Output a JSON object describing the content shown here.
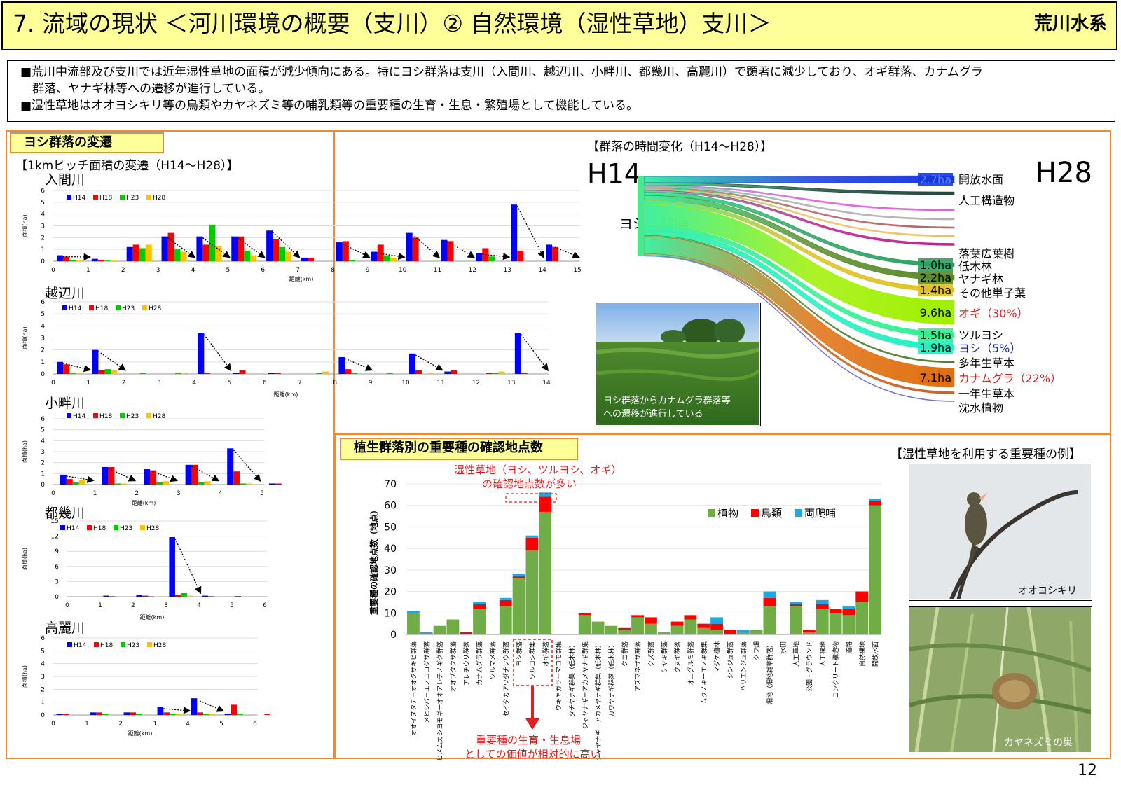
{
  "header": {
    "title": "7. 流域の現状 ＜河川環境の概要（支川）② 自然環境（湿性草地）支川＞",
    "system": "荒川水系"
  },
  "summary": {
    "line1": "■荒川中流部及び支川では近年湿性草地の面積が減少傾向にある。特にヨシ群落は支川（入間川、越辺川、小畔川、都幾川、高麗川）で顕著に減少しており、オギ群落、カナムグラ",
    "line2": "群落、ヤナギ林等への遷移が進行している。",
    "line3": "■湿性草地はオオヨシキリ等の鳥類やカヤネズミ等の哺乳類等の重要種の生育・生息・繁殖場として機能している。"
  },
  "left_panel": {
    "tag": "ヨシ群落の変遷",
    "subtitle": "【1kmピッチ面積の変遷（H14～H28）】",
    "ylabel": "面積(ha)",
    "xlabel": "距離(km)"
  },
  "right_top": {
    "subtitle": "【群落の時間変化（H14～H28）】",
    "h14": "H14",
    "h28": "H28",
    "source_label": "ヨシ",
    "source_value": "32ha",
    "photo_caption_1": "ヨシ群落からカナムグラ群落等",
    "photo_caption_2": "への遷移が進行している"
  },
  "right_bottom": {
    "tag": "植生群落別の重要種の確認地点数",
    "species_title": "【湿性草地を利用する重要種の例】",
    "annotation_top_1": "湿性草地（ヨシ、ツルヨシ、オギ）",
    "annotation_top_2": "の確認地点数が多い",
    "annotation_bottom_1": "重要種の生育・生息場",
    "annotation_bottom_2": "としての価値が相対的に高い",
    "photo_bird_caption": "オオヨシキリ",
    "photo_nest_caption": "カヤネズミの巣"
  },
  "page_number": "12",
  "colors": {
    "H14": "#0000ff",
    "H18": "#ff0000",
    "H23": "#00cc00",
    "H28": "#ffc000",
    "plant": "#70ad47",
    "bird": "#ff0000",
    "amphibian": "#1ea7e1",
    "orange": "#f08a2a"
  },
  "chart_data": [
    {
      "type": "bar",
      "title": "入間川",
      "xlabel": "距離(km)",
      "ylabel": "面積(ha)",
      "ylim": [
        0,
        6
      ],
      "yticks": [
        0,
        1,
        2,
        3,
        4,
        5,
        6
      ],
      "categories": [
        "0",
        "1",
        "2",
        "3",
        "4",
        "5",
        "6",
        "7",
        "8",
        "9",
        "10",
        "11",
        "12",
        "13",
        "14",
        "15"
      ],
      "series": [
        {
          "name": "H14",
          "values": [
            0.5,
            0.2,
            1.2,
            2.1,
            2.1,
            2.1,
            2.6,
            0.3,
            1.6,
            0.8,
            2.4,
            1.8,
            0.7,
            4.8,
            1.4,
            0
          ]
        },
        {
          "name": "H18",
          "values": [
            0.4,
            0.1,
            1.4,
            2.4,
            1.4,
            2.1,
            1.9,
            0.3,
            1.7,
            1.4,
            2.0,
            1.7,
            1.1,
            0.9,
            1.2,
            0
          ]
        },
        {
          "name": "H23",
          "values": [
            0.1,
            0.05,
            1.1,
            1.0,
            3.1,
            0.9,
            1.2,
            0,
            0.1,
            0.5,
            0,
            0,
            0.4,
            0,
            0,
            0
          ]
        },
        {
          "name": "H28",
          "values": [
            0.05,
            0.05,
            1.4,
            0.8,
            1.3,
            0.5,
            0.8,
            0,
            0,
            0.3,
            0,
            0,
            0,
            0,
            0,
            0
          ]
        }
      ]
    },
    {
      "type": "bar",
      "title": "越辺川",
      "xlabel": "距離(km)",
      "ylabel": "面積(ha)",
      "ylim": [
        0,
        6
      ],
      "yticks": [
        0,
        1,
        2,
        3,
        4,
        5,
        6
      ],
      "categories": [
        "0",
        "1",
        "2",
        "3",
        "4",
        "5",
        "6",
        "7",
        "8",
        "9",
        "10",
        "11",
        "12",
        "13",
        "14"
      ],
      "series": [
        {
          "name": "H14",
          "values": [
            1.0,
            2.0,
            0,
            0,
            3.4,
            0.1,
            0.1,
            0,
            1.4,
            0,
            1.7,
            0.2,
            0,
            3.4,
            0
          ]
        },
        {
          "name": "H18",
          "values": [
            0.8,
            0.3,
            0,
            0,
            0.1,
            0.3,
            0.1,
            0,
            0.4,
            0,
            0.3,
            0.3,
            0.1,
            0.1,
            0
          ]
        },
        {
          "name": "H23",
          "values": [
            0.1,
            0.4,
            0.1,
            0.1,
            0,
            0,
            0,
            0.1,
            0.1,
            0.1,
            0,
            0,
            0.1,
            0,
            0
          ]
        },
        {
          "name": "H28",
          "values": [
            0.1,
            0.3,
            0,
            0.1,
            0,
            0,
            0,
            0.2,
            0,
            0,
            0.1,
            0,
            0.2,
            0,
            0
          ]
        }
      ]
    },
    {
      "type": "bar",
      "title": "小畔川",
      "xlabel": "距離(km)",
      "ylabel": "面積(ha)",
      "ylim": [
        0,
        6
      ],
      "yticks": [
        0,
        1,
        2,
        3,
        4,
        5,
        6
      ],
      "categories": [
        "0",
        "1",
        "2",
        "3",
        "4",
        "5"
      ],
      "series": [
        {
          "name": "H14",
          "values": [
            0.9,
            1.6,
            1.4,
            1.8,
            3.3,
            0.1
          ]
        },
        {
          "name": "H18",
          "values": [
            0.5,
            1.6,
            1.3,
            1.8,
            1.2,
            0.1
          ]
        },
        {
          "name": "H23",
          "values": [
            0.2,
            0.1,
            0.2,
            0.2,
            0.1,
            0
          ]
        },
        {
          "name": "H28",
          "values": [
            0.4,
            0.1,
            0.3,
            0.3,
            0.1,
            0
          ]
        }
      ]
    },
    {
      "type": "bar",
      "title": "都幾川",
      "xlabel": "距離(km)",
      "ylabel": "面積(ha)",
      "ylim": [
        0,
        15
      ],
      "yticks": [
        0,
        3,
        6,
        9,
        12,
        15
      ],
      "categories": [
        "0",
        "1",
        "2",
        "3",
        "4",
        "5",
        "6"
      ],
      "series": [
        {
          "name": "H14",
          "values": [
            0,
            0.2,
            0.4,
            11.8,
            0.2,
            0.1,
            0
          ]
        },
        {
          "name": "H18",
          "values": [
            0,
            0.1,
            0.2,
            0.4,
            0.1,
            0,
            0
          ]
        },
        {
          "name": "H23",
          "values": [
            0,
            0,
            0.1,
            0.7,
            0,
            0,
            0
          ]
        },
        {
          "name": "H28",
          "values": [
            0,
            0,
            0,
            0.2,
            0,
            0,
            0
          ]
        }
      ]
    },
    {
      "type": "bar",
      "title": "高麗川",
      "xlabel": "距離(km)",
      "ylabel": "面積(ha)",
      "ylim": [
        0,
        6
      ],
      "yticks": [
        0,
        1,
        2,
        3,
        4,
        5,
        6
      ],
      "categories": [
        "0",
        "1",
        "2",
        "3",
        "4",
        "5",
        "6"
      ],
      "series": [
        {
          "name": "H14",
          "values": [
            0.1,
            0.2,
            0.2,
            0.6,
            1.3,
            0.1,
            0
          ]
        },
        {
          "name": "H18",
          "values": [
            0.1,
            0.2,
            0.2,
            0.2,
            0.2,
            0.8,
            0.1
          ]
        },
        {
          "name": "H23",
          "values": [
            0,
            0.1,
            0.1,
            0.1,
            0.1,
            0.1,
            0
          ]
        },
        {
          "name": "H28",
          "values": [
            0,
            0,
            0,
            0.1,
            0.1,
            0,
            0
          ]
        }
      ]
    },
    {
      "type": "sankey",
      "source": {
        "label": "ヨシ",
        "value": "32ha"
      },
      "targets": [
        {
          "label": "開放水面",
          "value": "2.7ha",
          "color": "#1438e0"
        },
        {
          "label": "人工構造物",
          "value": "",
          "color": "#1e4a3a"
        },
        {
          "label": "",
          "value": "",
          "color": "#e05be0"
        },
        {
          "label": "",
          "value": "",
          "color": "#b0b0b0"
        },
        {
          "label": "",
          "value": "",
          "color": "#c06060"
        },
        {
          "label": "",
          "value": "",
          "color": "#f0c060"
        },
        {
          "label": "落葉広葉樹",
          "value": "",
          "color": "#c02090"
        },
        {
          "label": "低木林",
          "value": "1.0ha",
          "color": "#2aa060"
        },
        {
          "label": "ヤナギ林",
          "value": "2.2ha",
          "color": "#5a8a2a"
        },
        {
          "label": "その他単子葉",
          "value": "1.4ha",
          "color": "#e0c020"
        },
        {
          "label": "オギ（30%）",
          "value": "9.6ha",
          "color": "#a0f000"
        },
        {
          "label": "ツルヨシ",
          "value": "1.5ha",
          "color": "#30f090"
        },
        {
          "label": "ヨシ（5%）",
          "value": "1.9ha",
          "color": "#20f0c0"
        },
        {
          "label": "多年生草本",
          "value": "",
          "color": "#508030"
        },
        {
          "label": "カナムグラ（22%）",
          "value": "7.1ha",
          "color": "#e07010"
        },
        {
          "label": "一年生草本",
          "value": "",
          "color": "#d06020"
        },
        {
          "label": "沈水植物",
          "value": "",
          "color": "#7070d0"
        }
      ]
    },
    {
      "type": "bar",
      "stacked": true,
      "title": "",
      "ylabel": "重要種の確認地点数（地点）",
      "ylim": [
        0,
        70
      ],
      "yticks": [
        0,
        10,
        20,
        30,
        40,
        50,
        60,
        70
      ],
      "categories": [
        "オオイヌタデーオオクサキビ群落",
        "メヒシバーエノコログサ群落",
        "ヒメムカシヨモギーオオアレチノギク群落",
        "オオブタクサ群落",
        "アレチウリ群落",
        "カナムグラ群落",
        "ツルマメ群落",
        "セイタカアワダチソウ群落",
        "ヨシ群落",
        "ツルヨシ群集",
        "オギ群落",
        "ウキヤガラーマコモ群集",
        "タチヤナギ群集（低木林）",
        "ジャヤナギーアカメヤナギ群集",
        "ジャヤナギーアカメヤナギ群集（低木林）",
        "カワヤナギ群落（低木林）",
        "クコ群落",
        "アズマネザサ群落",
        "クズ群落",
        "ケヤキ群落",
        "クヌギ群落",
        "オニグルミ群落",
        "ムクノキーエノキ群集",
        "マダケ植林",
        "シンジュ群落",
        "ハリエンジュ群落",
        "クワ畑",
        "畑地（畑地雑草群落）",
        "水田",
        "人工草地",
        "公園・グラウンド",
        "人工裸地",
        "コンクリート構造物",
        "道路",
        "自然裸地",
        "開放水面"
      ],
      "legend": "top-right",
      "series": [
        {
          "name": "植物",
          "values": [
            10,
            0,
            4,
            7,
            0,
            12,
            0,
            13,
            26,
            39,
            57,
            0,
            0,
            9,
            6,
            4,
            2,
            8,
            5,
            1,
            4,
            7,
            3,
            2,
            0,
            1,
            2,
            13,
            0,
            13,
            1,
            12,
            10,
            9,
            15,
            60
          ]
        },
        {
          "name": "鳥類",
          "values": [
            0,
            0,
            0,
            0,
            1,
            2,
            0,
            3,
            1,
            6,
            7,
            0,
            0,
            1,
            0,
            0,
            1,
            1,
            3,
            0,
            2,
            2,
            2,
            3,
            2,
            0,
            0,
            4,
            0,
            1,
            1,
            2,
            2,
            3,
            5,
            2
          ]
        },
        {
          "name": "両爬哺",
          "values": [
            1,
            1,
            0,
            0,
            0,
            1,
            0,
            1,
            1,
            1,
            2,
            0,
            0,
            0,
            0,
            0,
            0,
            0,
            0,
            0,
            0,
            0,
            0,
            3,
            0,
            1,
            0,
            3,
            0,
            1,
            0,
            2,
            0,
            1,
            0,
            1
          ]
        }
      ]
    }
  ]
}
